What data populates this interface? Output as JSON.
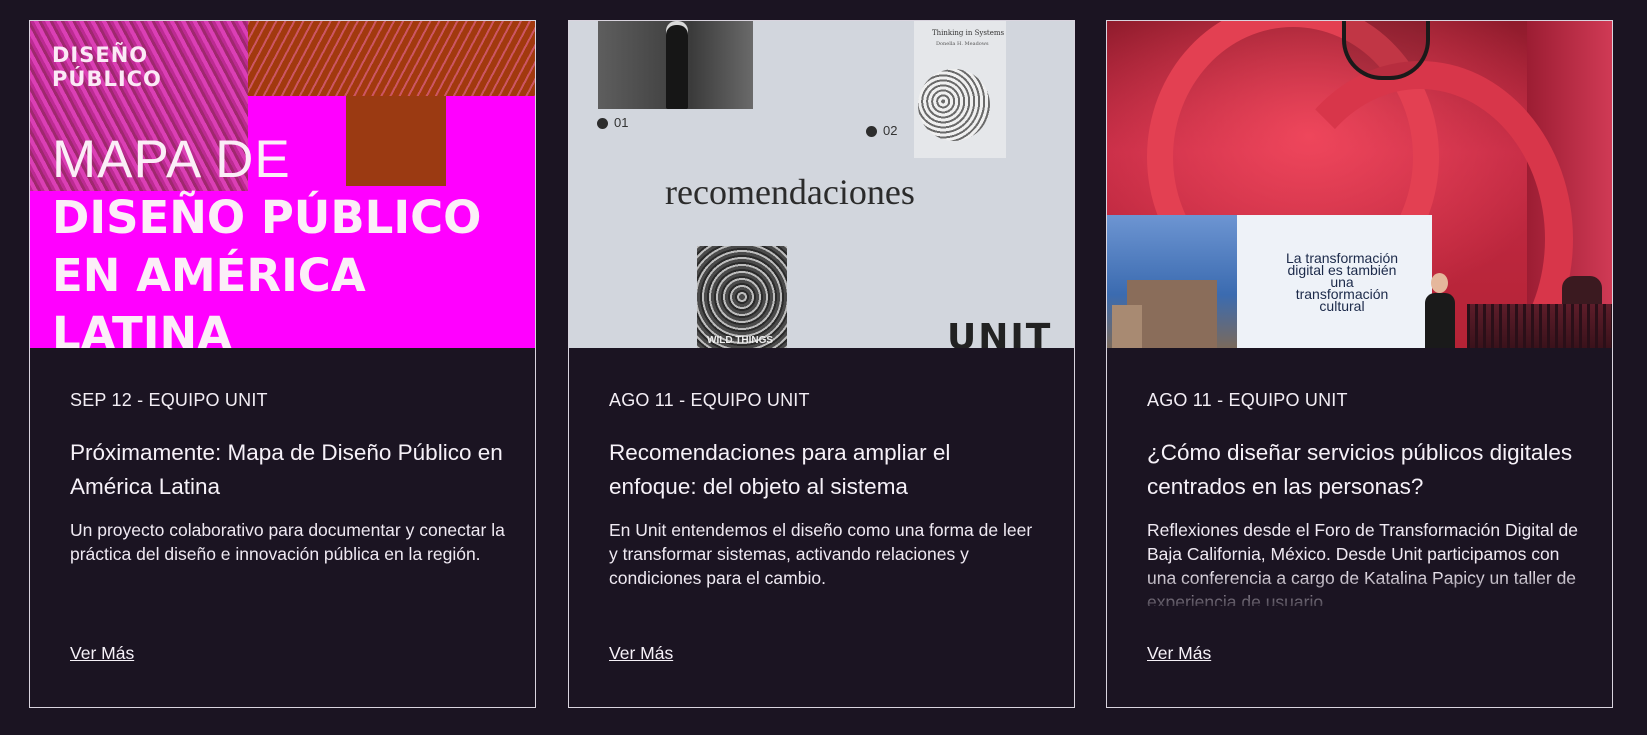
{
  "cards": [
    {
      "image": {
        "logo_line1": "DISEÑO",
        "logo_line2": "PÚBLICO",
        "headline_line1": "MAPA DE",
        "headline_line2": "DISEÑO PÚBLICO",
        "headline_line3": "EN AMÉRICA",
        "headline_line4": "LATINA"
      },
      "meta": "SEP 12 - EQUIPO UNIT",
      "title": "Próximamente: Mapa de Diseño Público en América Latina",
      "excerpt": "Un proyecto colaborativo para documentar y conectar la práctica del diseño e innovación pública en la región.",
      "link": "Ver Más"
    },
    {
      "image": {
        "label_01": "01",
        "label_02": "02",
        "word": "recomendaciones",
        "book_title": "Thinking in Systems",
        "book_author": "Donella H. Meadows",
        "book2_text": "WILD THINGS",
        "brand": "UNIT"
      },
      "meta": "AGO 11 - EQUIPO UNIT",
      "title": "Recomendaciones para ampliar el enfoque: del objeto al sistema",
      "excerpt": "En Unit entendemos el diseño como una forma de leer y transformar sistemas, activando relaciones y condiciones para el cambio.",
      "link": "Ver Más"
    },
    {
      "image": {
        "slide_line1": "La transformación",
        "slide_line2": "digital es también",
        "slide_line3": "una",
        "slide_line4": "transformación",
        "slide_line5": "cultural"
      },
      "meta": "AGO 11 - EQUIPO UNIT",
      "title": "¿Cómo diseñar servicios públicos digitales centrados en las personas?",
      "excerpt": "Reflexiones desde el Foro de Transformación Digital de Baja California, México. Desde Unit participamos con una conferencia a cargo de Katalina Papicy un taller de experiencia de usuario.",
      "link": "Ver Más"
    }
  ]
}
